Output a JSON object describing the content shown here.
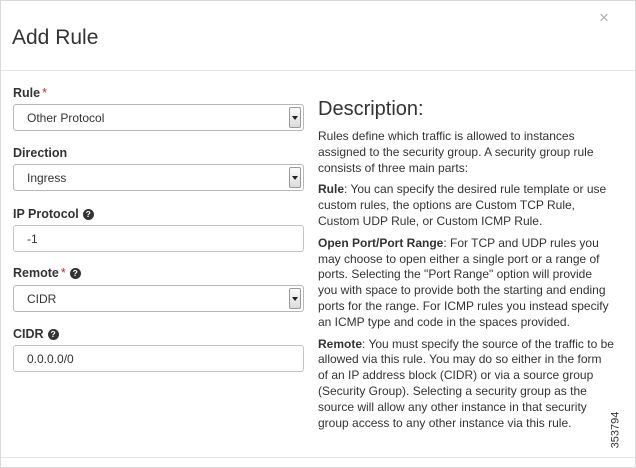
{
  "dialog": {
    "title": "Add Rule",
    "close_glyph": "×"
  },
  "form": {
    "rule": {
      "label": "Rule",
      "required_mark": "*",
      "value": "Other Protocol"
    },
    "direction": {
      "label": "Direction",
      "value": "Ingress"
    },
    "ip_protocol": {
      "label": "IP Protocol",
      "value": "-1",
      "help_icon": "question-circle-icon"
    },
    "remote": {
      "label": "Remote",
      "required_mark": "*",
      "value": "CIDR",
      "help_icon": "question-circle-icon"
    },
    "cidr": {
      "label": "CIDR",
      "value": "0.0.0.0/0",
      "help_icon": "question-circle-icon"
    }
  },
  "description": {
    "heading": "Description:",
    "intro": "Rules define which traffic is allowed to instances assigned to the security group. A security group rule consists of three main parts:",
    "rule_term": "Rule",
    "rule_text": ": You can specify the desired rule template or use custom rules, the options are Custom TCP Rule, Custom UDP Rule, or Custom ICMP Rule.",
    "port_term": "Open Port/Port Range",
    "port_text": ": For TCP and UDP rules you may choose to open either a single port or a range of ports. Selecting the \"Port Range\" option will provide you with space to provide both the starting and ending ports for the range. For ICMP rules you instead specify an ICMP type and code in the spaces provided.",
    "remote_term": "Remote",
    "remote_text": ": You must specify the source of the traffic to be allowed via this rule. You may do so either in the form of an IP address block (CIDR) or via a source group (Security Group). Selecting a security group as the source will allow any other instance in that security group access to any other instance via this rule."
  },
  "figure_number": "353794"
}
